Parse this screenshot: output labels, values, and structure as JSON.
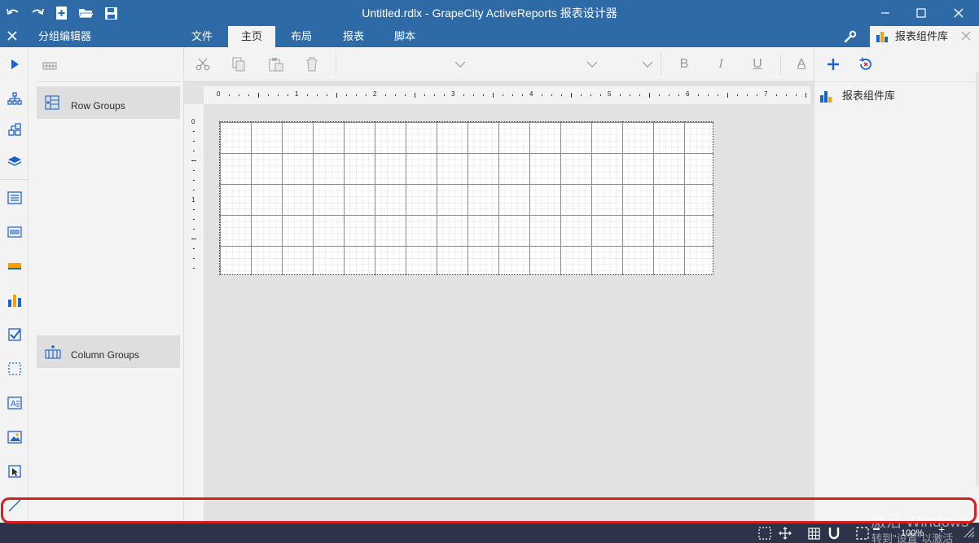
{
  "window": {
    "title": "Untitled.rdlx - GrapeCity ActiveReports 报表设计器"
  },
  "menubar": {
    "panel_title": "分组编辑器",
    "tabs": [
      "文件",
      "主页",
      "布局",
      "报表",
      "脚本"
    ],
    "active_tab": "主页"
  },
  "group_editor": {
    "row_groups": "Row Groups",
    "column_groups": "Column Groups"
  },
  "toolbar": {
    "bold": "B",
    "italic": "I",
    "underline": "U",
    "font_color": "A"
  },
  "ruler": {
    "h_labels": [
      "0",
      "1",
      "2",
      "3",
      "4",
      "5",
      "6",
      "7"
    ],
    "v_labels": [
      "0",
      "1"
    ]
  },
  "right_panel": {
    "tab_label": "报表组件库",
    "tree_item": "报表组件库"
  },
  "statusbar": {
    "zoom": "100%",
    "watermark_line1": "激活 Windows",
    "watermark_line2": "转到\"设置\"以激活"
  },
  "colors": {
    "title_blue": "#2e6aa6",
    "status_dark": "#2d3449",
    "accent_blue": "#1e64c8",
    "highlight_red": "#d42020"
  }
}
